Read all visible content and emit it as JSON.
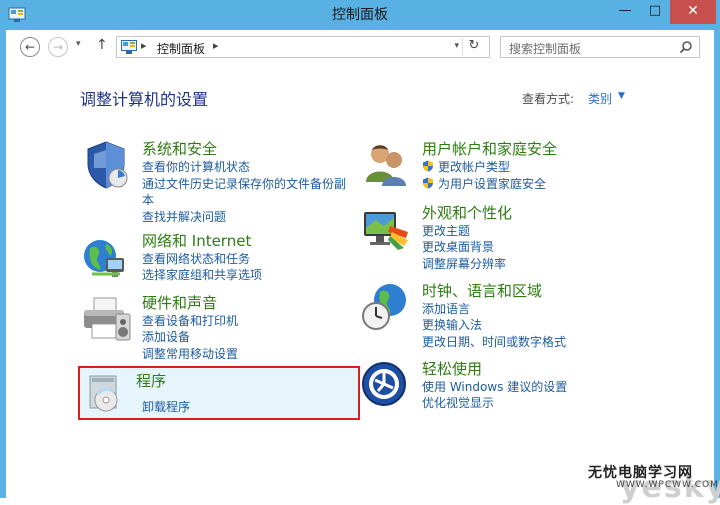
{
  "window": {
    "title": "控制面板",
    "min_glyph": "—",
    "max_glyph": "□",
    "close_glyph": "✕"
  },
  "nav": {
    "back_glyph": "←",
    "forward_glyph": "→",
    "recent_glyph": "▾",
    "up_glyph": "↑",
    "address_sep1": "▸",
    "address_text": "控制面板",
    "address_sep2": "▸",
    "address_drop": "▾",
    "refresh_glyph": "↻",
    "search_placeholder": "搜索控制面板"
  },
  "main": {
    "heading": "调整计算机的设置",
    "view_by_label": "查看方式:",
    "view_by_value": "类别",
    "view_caret": "▼"
  },
  "categories": [
    {
      "title": "系统和安全",
      "links": [
        "查看你的计算机状态",
        "通过文件历史记录保存你的文件备份副",
        "本",
        "查找并解决问题"
      ]
    },
    {
      "title": "网络和 Internet",
      "links": [
        "查看网络状态和任务",
        "选择家庭组和共享选项"
      ]
    },
    {
      "title": "硬件和声音",
      "links": [
        "查看设备和打印机",
        "添加设备",
        "调整常用移动设置"
      ]
    },
    {
      "title": "程序",
      "links": [
        "卸载程序"
      ]
    },
    {
      "title": "用户帐户和家庭安全",
      "links": [
        "更改帐户类型",
        "为用户设置家庭安全"
      ]
    },
    {
      "title": "外观和个性化",
      "links": [
        "更改主题",
        "更改桌面背景",
        "调整屏幕分辨率"
      ]
    },
    {
      "title": "时钟、语言和区域",
      "links": [
        "添加语言",
        "更换输入法",
        "更改日期、时间或数字格式"
      ]
    },
    {
      "title": "轻松使用",
      "links": [
        "使用 Windows 建议的设置",
        "优化视觉显示"
      ]
    }
  ],
  "watermark": {
    "brand": "yesky",
    "site_cn": "无忧电脑学习网",
    "site_url": "WWW.WPCWW.COM"
  },
  "colors": {
    "titlebar": "#58b1e2",
    "category_title": "#2e7d12",
    "link": "#1c5b9f",
    "heading": "#1e3287",
    "highlight_border": "#d62020"
  }
}
